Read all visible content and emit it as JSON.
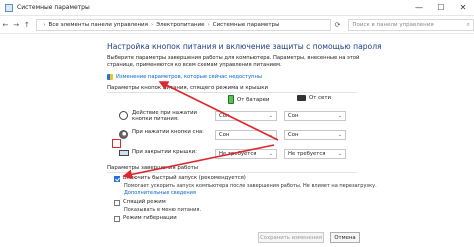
{
  "window": {
    "title": "Системные параметры",
    "controls": {
      "minimize": "—",
      "maximize": "☐",
      "close": "✕"
    }
  },
  "address_bar": {
    "back": "←",
    "forward": "→",
    "up": "↑",
    "path": [
      "Все элементы панели управления",
      "Электропитание",
      "Системные параметры"
    ],
    "refresh": "⟳",
    "search_placeholder": "Поиск в панели управления"
  },
  "page": {
    "heading": "Настройка кнопок питания и включение защиты с помощью пароля",
    "description": "Выберите параметры завершения работы для компьютера. Параметры, внесенные на этой странице, применяются ко всем схемам управления питанием.",
    "change_link": "Изменение параметров, которые сейчас недоступны"
  },
  "power_settings": {
    "section_title": "Параметры кнопок питания, спящего режима и крышки",
    "col_battery": "От батареи",
    "col_ac": "От сети",
    "rows": [
      {
        "label": "Действие при нажатии кнопки питания:",
        "battery": "Сон",
        "ac": "Сон"
      },
      {
        "label": "При нажатии кнопки сна:",
        "battery": "Сон",
        "ac": "Сон"
      },
      {
        "label": "При закрытии крышки:",
        "battery": "Не требуется",
        "ac": "Не требуется"
      }
    ]
  },
  "shutdown": {
    "section_title": "Параметры завершения работы",
    "fast_startup": {
      "label": "Включить быстрый запуск (рекомендуется)",
      "checked": true,
      "help": "Помогает ускорить запуск компьютера после завершения работы. Не влияет на перезагрузку.",
      "more": "Дополнительные сведения"
    },
    "sleep": {
      "label": "Спящий режим",
      "checked": false,
      "help": "Показывать в меню питания."
    },
    "hibernate": {
      "label": "Режим гибернации",
      "checked": false
    }
  },
  "buttons": {
    "save": "Сохранить изменения",
    "cancel": "Отмена"
  },
  "colors": {
    "heading": "#1e3f83",
    "link": "#0066cc",
    "annotation": "#e0262d",
    "checkbox": "#2b6fd4"
  }
}
